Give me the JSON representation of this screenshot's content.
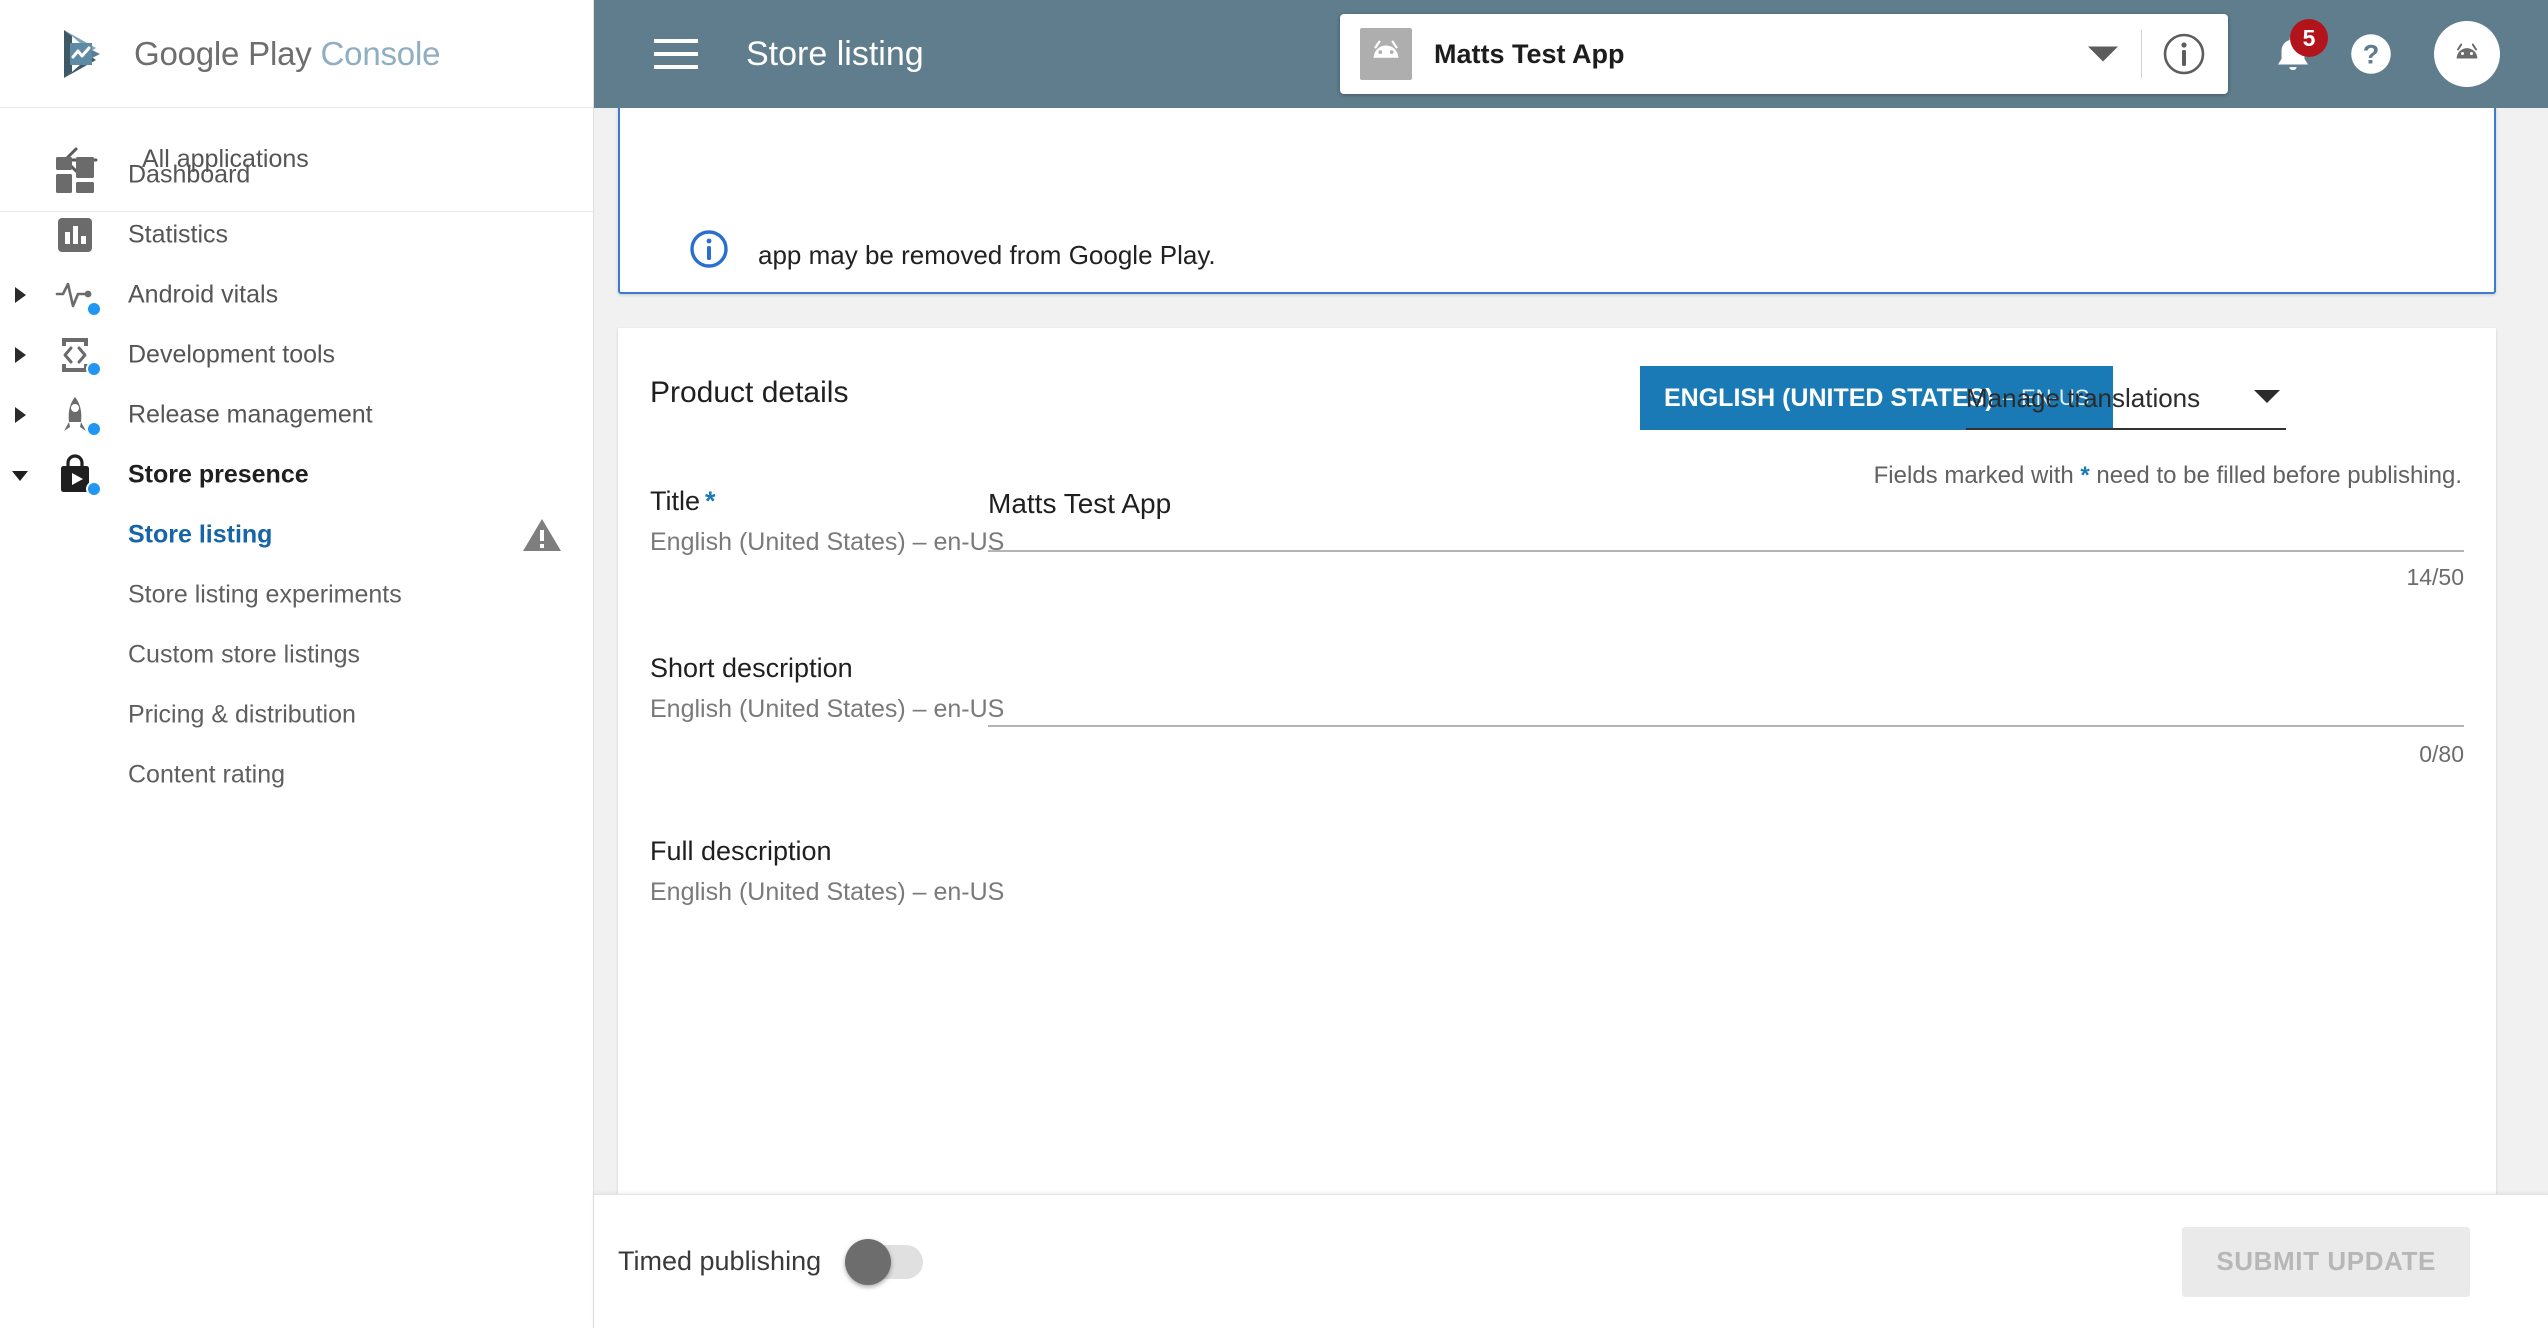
{
  "brand": {
    "name_primary": "Google Play",
    "name_secondary": "Console",
    "logo_icon": "google-play-console-logo-icon"
  },
  "sidebar": {
    "back": {
      "label": "All applications",
      "icon": "arrow-left-icon"
    },
    "items": [
      {
        "label": "Dashboard",
        "icon": "dashboard-icon",
        "expandable": false,
        "badge_dot": false
      },
      {
        "label": "Statistics",
        "icon": "bar-chart-icon",
        "expandable": false,
        "badge_dot": false
      },
      {
        "label": "Android vitals",
        "icon": "pulse-icon",
        "expandable": true,
        "badge_dot": true
      },
      {
        "label": "Development tools",
        "icon": "code-device-icon",
        "expandable": true,
        "badge_dot": true
      },
      {
        "label": "Release management",
        "icon": "rocket-icon",
        "expandable": true,
        "badge_dot": true
      },
      {
        "label": "Store presence",
        "icon": "store-bag-icon",
        "expandable": true,
        "expanded": true,
        "badge_dot": true
      }
    ],
    "sub_items": [
      {
        "label": "Store listing",
        "active": true,
        "warning_icon": "warning-triangle-icon"
      },
      {
        "label": "Store listing experiments",
        "active": false
      },
      {
        "label": "Custom store listings",
        "active": false
      },
      {
        "label": "Pricing & distribution",
        "active": false
      },
      {
        "label": "Content rating",
        "active": false
      }
    ]
  },
  "header": {
    "menu_icon": "hamburger-menu-icon",
    "title": "Store listing",
    "app_selector": {
      "app_name": "Matts Test App",
      "app_thumb_icon": "android-robot-icon",
      "caret_icon": "chevron-down-icon",
      "info_icon": "info-circle-icon"
    },
    "notifications": {
      "icon": "bell-icon",
      "count": "5"
    },
    "help": {
      "icon": "help-question-icon"
    },
    "avatar": {
      "icon": "android-robot-icon"
    },
    "bar_color": "#5f7d8c"
  },
  "notice": {
    "icon": "info-circle-icon",
    "text": "app may be removed from Google Play."
  },
  "product_details": {
    "title": "Product details",
    "language_chip": {
      "main": "ENGLISH (UNITED STATES)",
      "sub": "– EN-US",
      "color": "#1a7ab5"
    },
    "manage_translations": {
      "label": "Manage translations",
      "caret_icon": "chevron-down-icon"
    },
    "required_note_before": "Fields marked with",
    "required_note_asterisk": "*",
    "required_note_after": "need to be filled before publishing.",
    "fields": [
      {
        "label": "Title",
        "required": true,
        "asterisk": "*",
        "sublabel": "English (United States) – en-US",
        "value": "Matts Test App",
        "placeholder": "",
        "counter": "14/50"
      },
      {
        "label": "Short description",
        "required": false,
        "asterisk": "",
        "sublabel": "English (United States) – en-US",
        "value": "",
        "placeholder": "",
        "counter": "0/80"
      },
      {
        "label": "Full description",
        "required": false,
        "asterisk": "",
        "sublabel": "English (United States) – en-US",
        "value": "",
        "placeholder": "",
        "counter": ""
      }
    ]
  },
  "footer": {
    "timed_publishing_label": "Timed publishing",
    "timed_publishing_on": false,
    "submit_label": "SUBMIT UPDATE",
    "submit_disabled": true
  }
}
